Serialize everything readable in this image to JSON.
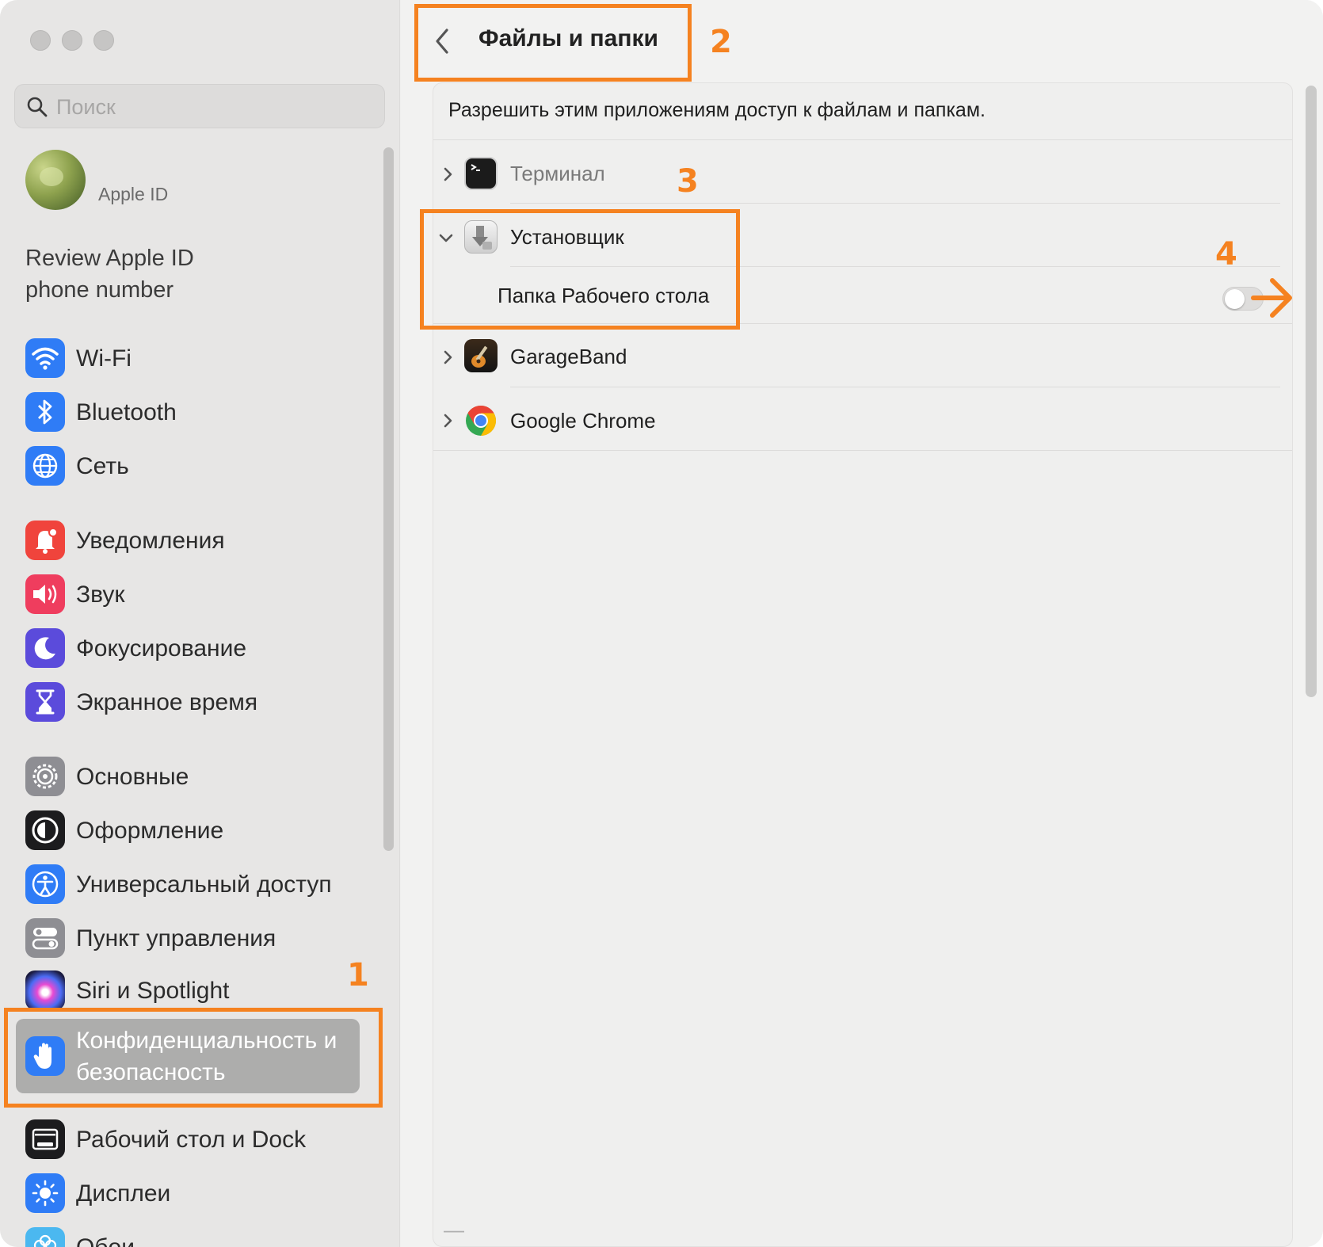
{
  "window": {
    "traffic_lights": [
      "close",
      "minimize",
      "zoom"
    ]
  },
  "sidebar": {
    "search": {
      "placeholder": "Поиск",
      "value": ""
    },
    "apple_id": {
      "label": "Apple ID"
    },
    "review_notice": "Review Apple ID phone number",
    "items": [
      {
        "label": "Wi-Fi",
        "icon": "wifi-icon",
        "color": "#2f7cf6"
      },
      {
        "label": "Bluetooth",
        "icon": "bluetooth-icon",
        "color": "#2f7cf6"
      },
      {
        "label": "Сеть",
        "icon": "globe-icon",
        "color": "#2f7cf6"
      },
      {
        "label": "Уведомления",
        "icon": "bell-icon",
        "color": "#f0443c"
      },
      {
        "label": "Звук",
        "icon": "speaker-icon",
        "color": "#ef3d5e"
      },
      {
        "label": "Фокусирование",
        "icon": "moon-icon",
        "color": "#5b4bdb"
      },
      {
        "label": "Экранное время",
        "icon": "hourglass-icon",
        "color": "#5b4bdb"
      },
      {
        "label": "Основные",
        "icon": "gear-icon",
        "color": "#8e8e93"
      },
      {
        "label": "Оформление",
        "icon": "appearance-icon",
        "color": "#1c1c1e"
      },
      {
        "label": "Универсальный доступ",
        "icon": "accessibility-icon",
        "color": "#2f7cf6"
      },
      {
        "label": "Пункт управления",
        "icon": "control-center-icon",
        "color": "#8e8e93"
      },
      {
        "label": "Siri и Spotlight",
        "icon": "siri-icon",
        "color": "#7a3df0"
      },
      {
        "label": "Конфиденциальность и безопасность",
        "icon": "hand-icon",
        "color": "#2f7cf6",
        "selected": true
      },
      {
        "label": "Рабочий стол и Dock",
        "icon": "dock-icon",
        "color": "#1c1c1e"
      },
      {
        "label": "Дисплеи",
        "icon": "sun-icon",
        "color": "#2f7cf6"
      },
      {
        "label": "Обои",
        "icon": "wallpaper-icon",
        "color": "#4bb8f0"
      }
    ]
  },
  "main": {
    "title": "Файлы и папки",
    "description": "Разрешить этим приложениям доступ к файлам и папкам.",
    "apps": [
      {
        "name": "Терминал",
        "icon": "terminal-icon",
        "expanded": false,
        "dimmed": true
      },
      {
        "name": "Установщик",
        "icon": "installer-icon",
        "expanded": true,
        "dimmed": false,
        "children": [
          {
            "name": "Папка Рабочего стола",
            "enabled": false
          }
        ]
      },
      {
        "name": "GarageBand",
        "icon": "garageband-icon",
        "expanded": false,
        "dimmed": false
      },
      {
        "name": "Google Chrome",
        "icon": "chrome-icon",
        "expanded": false,
        "dimmed": false
      }
    ],
    "remove_button": "—"
  },
  "annotations": {
    "color": "#f58220",
    "labels": [
      "1",
      "2",
      "3",
      "4"
    ]
  }
}
